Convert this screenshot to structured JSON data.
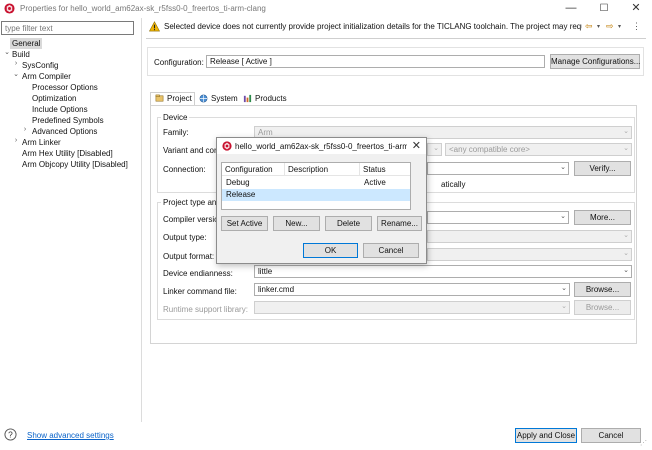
{
  "window": {
    "title": "Properties for hello_world_am62ax-sk_r5fss0-0_freertos_ti-arm-clang",
    "minimize": "—",
    "maximize": "☐",
    "close": "✕"
  },
  "filter": {
    "placeholder": "type filter text"
  },
  "tree": [
    {
      "label": "General",
      "selected": true
    },
    {
      "label": "Build",
      "expander": "⌄"
    },
    {
      "label": "SysConfig",
      "expander": "›"
    },
    {
      "label": "Arm Compiler",
      "expander": "⌄"
    },
    {
      "label": "Processor Options"
    },
    {
      "label": "Optimization"
    },
    {
      "label": "Include Options"
    },
    {
      "label": "Predefined Symbols"
    },
    {
      "label": "Advanced Options",
      "expander": "›"
    },
    {
      "label": "Arm Linker",
      "expander": "›"
    },
    {
      "label": "Arm Hex Utility  [Disabled]"
    },
    {
      "label": "Arm Objcopy Utility  [Disabled]"
    }
  ],
  "message": {
    "text": "Selected device does not currently provide project initialization details for the TICLANG toolchain. The project may require furth",
    "nav_back": "⇦",
    "nav_forward": "⇨",
    "dropdown": "▾",
    "menu": "⋮"
  },
  "configuration": {
    "label": "Configuration:",
    "value": "Release  [ Active ]",
    "manage_button": "Manage Configurations..."
  },
  "tabs": [
    {
      "label": "Project",
      "active": true
    },
    {
      "label": "System"
    },
    {
      "label": "Products"
    }
  ],
  "device": {
    "group_title": "Device",
    "family_label": "Family:",
    "family_value": "Arm",
    "variant_label": "Variant and core:",
    "variant_filter_value": "",
    "variant_core_value": "<any compatible core>",
    "connection_label": "Connection:",
    "verify_button": "Verify...",
    "auto_text": "atically"
  },
  "project_type": {
    "group_title": "Project type and",
    "compiler_label": "Compiler version",
    "more_button": "More...",
    "output_type_label": "Output type:",
    "output_format_label": "Output format:",
    "endianness_label": "Device endianness:",
    "endianness_value": "little",
    "linker_label": "Linker command file:",
    "linker_value": "linker.cmd",
    "browse_button": "Browse...",
    "runtime_label": "Runtime support library:",
    "runtime_browse": "Browse..."
  },
  "dialog": {
    "title": "hello_world_am62ax-sk_r5fss0-0_freertos_ti-arm-cl...",
    "close": "✕",
    "columns": [
      "Configuration",
      "Description",
      "Status"
    ],
    "rows": [
      {
        "configuration": "Debug",
        "description": "",
        "status": "Active"
      },
      {
        "configuration": "Release",
        "description": "",
        "status": ""
      }
    ],
    "set_active": "Set Active",
    "new": "New...",
    "delete": "Delete",
    "rename": "Rename...",
    "ok": "OK",
    "cancel": "Cancel"
  },
  "footer": {
    "show_advanced": "Show advanced settings",
    "apply_close": "Apply and Close",
    "cancel": "Cancel"
  },
  "colors": {
    "link": "#0a63c9",
    "selection": "#cce8ff",
    "ti_red": "#c8102e",
    "warning": "#f2b705"
  }
}
